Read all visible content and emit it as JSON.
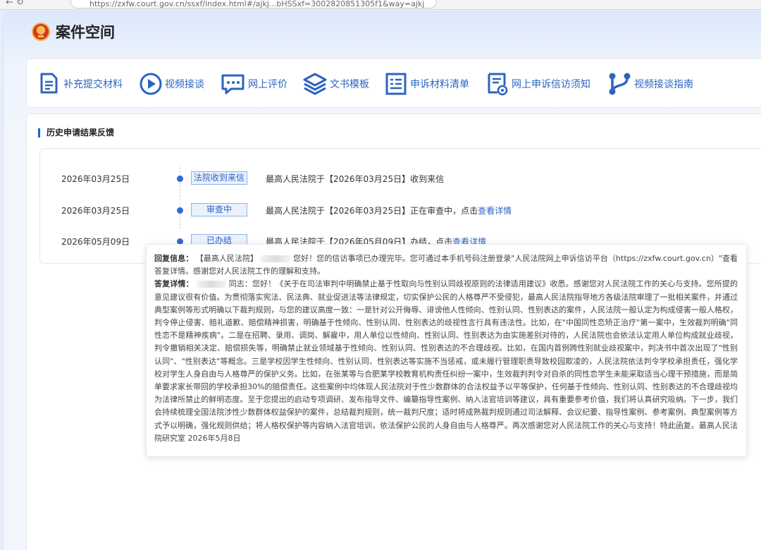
{
  "browser": {
    "url": "https://zxfw.court.gov.cn/ssxf/index.html#/ajkj...bHSSxf=3002820851305f1&way=ajkj",
    "nav_glyphs": "← ↻"
  },
  "header": {
    "title": "案件空间"
  },
  "toolbar": {
    "items": [
      {
        "label": "补充提交材料",
        "icon": "document-add-icon"
      },
      {
        "label": "视频接谈",
        "icon": "play-circle-icon"
      },
      {
        "label": "网上评价",
        "icon": "chat-bubble-icon"
      },
      {
        "label": "文书模板",
        "icon": "layers-icon"
      },
      {
        "label": "申诉材料清单",
        "icon": "list-document-icon"
      },
      {
        "label": "网上申诉信访须知",
        "icon": "notice-document-icon"
      },
      {
        "label": "视频接谈指南",
        "icon": "branch-icon"
      }
    ]
  },
  "history": {
    "title": "历史申请结果反馈",
    "entries": [
      {
        "date": "2026年03月25日",
        "status": "法院收到来信",
        "text": "最高人民法院于【2026年03月25日】收到来信",
        "link": ""
      },
      {
        "date": "2026年03月25日",
        "status": "审查中",
        "text": "最高人民法院于【2026年03月25日】正在审查中，点击",
        "link": "查看详情"
      },
      {
        "date": "2026年05月09日",
        "status": "已办结",
        "text": "最高人民法院于【2026年05月09日】办结，点击",
        "link": "查看详情"
      }
    ]
  },
  "popup": {
    "reply_label": "回复信息：",
    "reply_prefix": "【最高人民法院】",
    "reply_text": "您好！您的信访事项已办理完毕。您可通过本手机号码注册登录\"人民法院网上申诉信访平台（https://zxfw.court.gov.cn）\"查看答复详情。感谢您对人民法院工作的理解和支持。",
    "detail_label": "答复详情：",
    "detail_text": "同志：您好！《关于在司法审判中明确禁止基于性取向与性别认同歧视原则的法律适用建议》收悉。感谢您对人民法院工作的关心与支持。您所提的意见建议很有价值。为贯彻落实宪法、民法典、就业促进法等法律规定，切实保护公民的人格尊严不受侵犯，最高人民法院指导地方各级法院审理了一批相关案件，并通过典型案例等形式明确以下裁判规则，与您的建议高度一致：一是针对公开侮辱、诽谤他人性倾向、性别认同、性别表达的案件，人民法院一般认定为构成侵害一般人格权，判令停止侵害、赔礼道歉、赔偿精神损害，明确基于性倾向、性别认同、性别表达的歧视性言行具有违法性。比如，在\"中国同性恋矫正治疗\"第一案中，生效裁判明确\"同性恋不是精神疾病\"。二是在招聘、录用、调岗、解雇中，用人单位以性倾向、性别认同、性别表达为由实施差别对待的，人民法院也会依法认定用人单位构成就业歧视，判令撤销相关决定、赔偿损失等，明确禁止就业领域基于性倾向、性别认同、性别表达的不合理歧视。比如，在国内首例跨性别就业歧视案中，判决书中首次出现了\"性别认同\"、\"性别表达\"等概念。三是学校因学生性倾向、性别认同、性别表达等实施不当惩戒，或未履行管理职责导致校园欺凌的，人民法院依法判令学校承担责任，强化学校对学生人身自由与人格尊严的保护义务。比如，在张某等与合肥某学校教育机构责任纠纷一案中，生效裁判判令对自杀的同性恋学生未能采取适当心理干预措施，而是简单要求家长带回的学校承担30%的赔偿责任。这些案例中均体现人民法院对于性少数群体的合法权益予以平等保护，任何基于性倾向、性别认同、性别表达的不合理歧视均为法律所禁止的鲜明态度。至于您提出的启动专项调研、发布指导文件、编纂指导性案例、纳入法官培训等建议，具有重要参考价值，我们将认真研究吸纳。下一步，我们会持续梳理全国法院涉性少数群体权益保护的案件，总结裁判规则，统一裁判尺度；适时将成熟裁判规则通过司法解释、会议纪要、指导性案例、参考案例、典型案例等方式予以明确，强化规则供给；将人格权保护等内容纳入法官培训，依法保护公民的人身自由与人格尊严。再次感谢您对人民法院工作的关心与支持！特此函复。最高人民法院研究室 2026年5月8日"
  },
  "colors": {
    "accent": "#2c64c0",
    "dot": "#2e6ad8",
    "badge_bg": "#eaf1fc",
    "badge_border": "#8eb1e6",
    "page_bg": "#e6eefb"
  }
}
